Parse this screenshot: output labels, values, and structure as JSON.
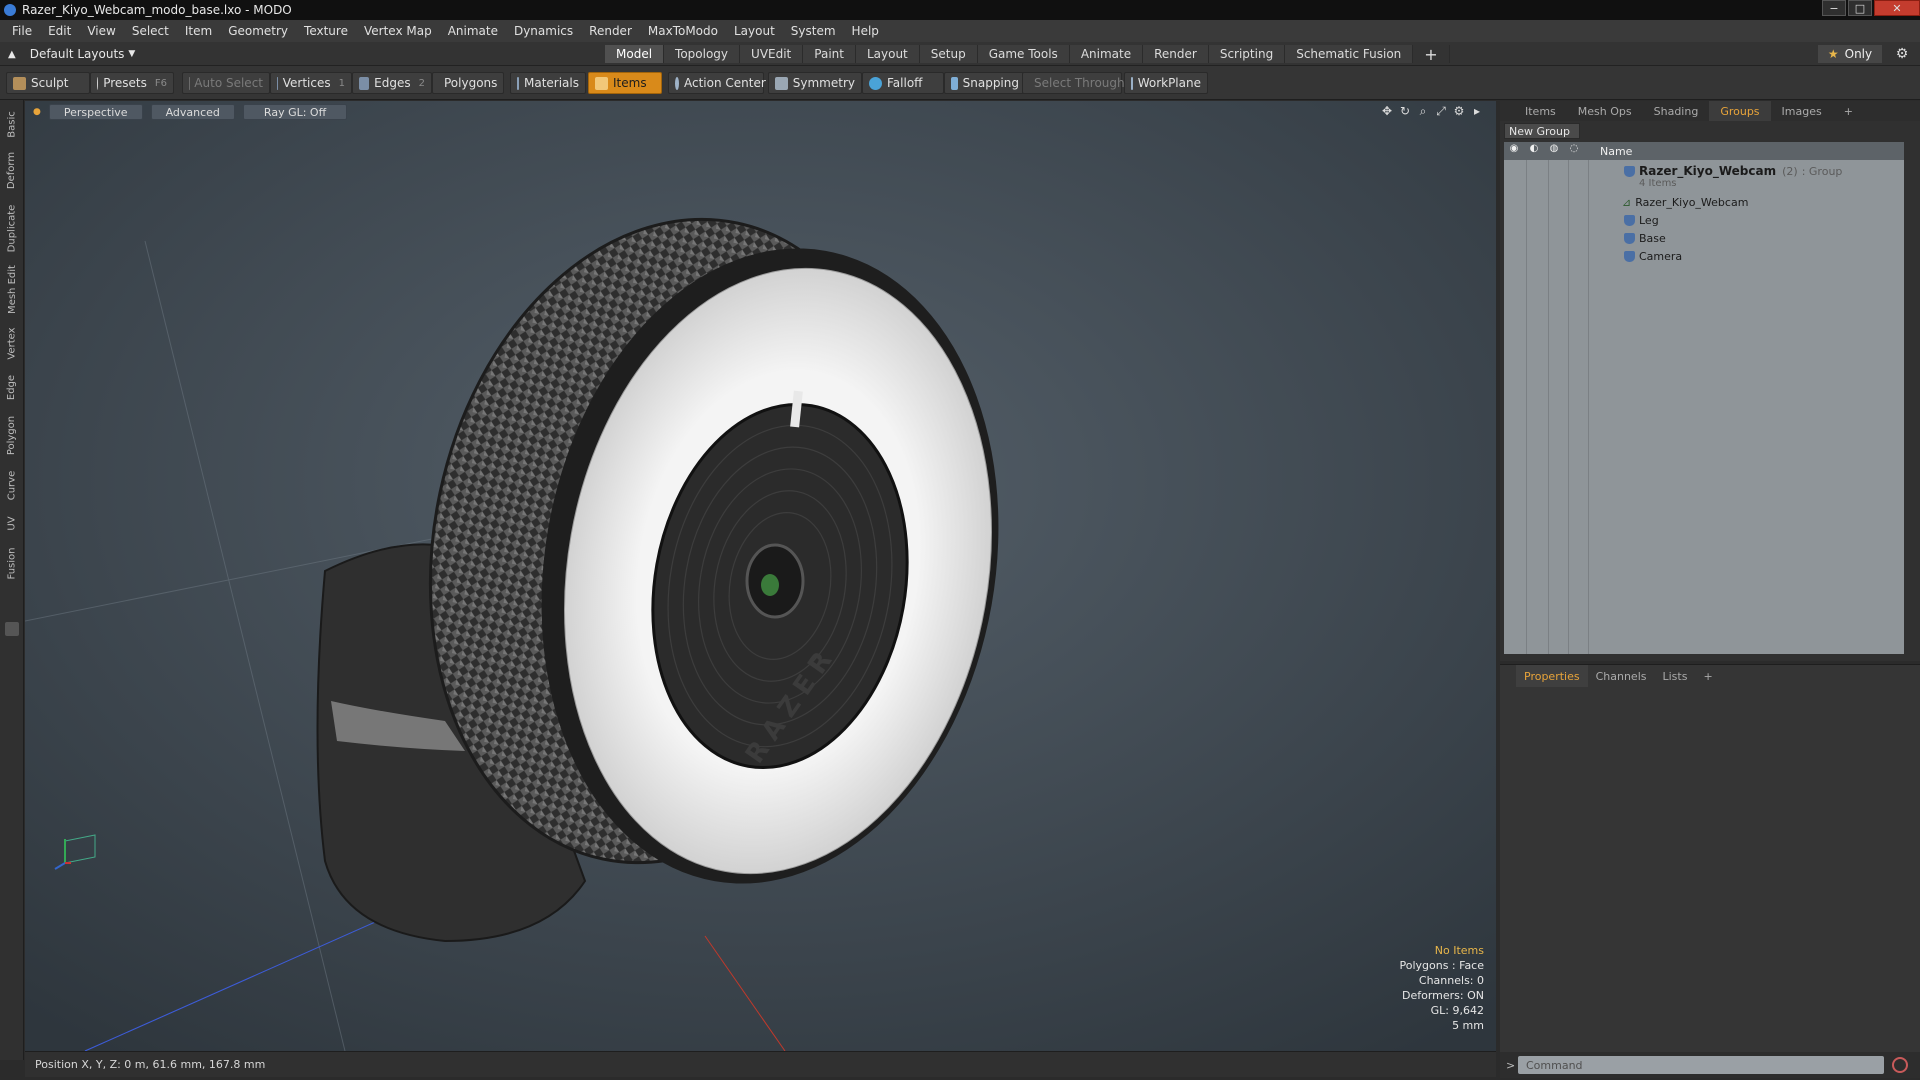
{
  "window": {
    "title": "Razer_Kiyo_Webcam_modo_base.lxo - MODO",
    "minimize": "−",
    "maximize": "□",
    "close": "✕"
  },
  "menu": [
    "File",
    "Edit",
    "View",
    "Select",
    "Item",
    "Geometry",
    "Texture",
    "Vertex Map",
    "Animate",
    "Dynamics",
    "Render",
    "MaxToModo",
    "Layout",
    "System",
    "Help"
  ],
  "layout": {
    "selected": "Default Layouts",
    "only_label": "Only"
  },
  "modetabs": [
    "Model",
    "Topology",
    "UVEdit",
    "Paint",
    "Layout",
    "Setup",
    "Game Tools",
    "Animate",
    "Render",
    "Scripting",
    "Schematic Fusion"
  ],
  "toolbar": {
    "sculpt": "Sculpt",
    "presets": "Presets",
    "presets_key": "F6",
    "auto_select": "Auto Select",
    "vertices": "Vertices",
    "vertices_key": "1",
    "edges": "Edges",
    "edges_key": "2",
    "polygons": "Polygons",
    "materials": "Materials",
    "items": "Items",
    "action_center": "Action Center",
    "symmetry": "Symmetry",
    "falloff": "Falloff",
    "snapping": "Snapping",
    "select_through": "Select Through",
    "workplane": "WorkPlane"
  },
  "lefttabs": [
    "Basic",
    "Deform",
    "Duplicate",
    "Mesh Edit",
    "Vertex",
    "Edge",
    "Polygon",
    "Curve",
    "UV",
    "Fusion"
  ],
  "viewport": {
    "view": "Perspective",
    "shading": "Advanced",
    "raygl": "Ray GL: Off",
    "logo_text": "RAZER",
    "info": {
      "no_items": "No Items",
      "polygons": "Polygons : Face",
      "channels": "Channels: 0",
      "deformers": "Deformers: ON",
      "gl": "GL: 9,642",
      "scale": "5 mm"
    }
  },
  "status": {
    "position": "Position X, Y, Z:  0 m, 61.6 mm, 167.8 mm"
  },
  "groups_panel": {
    "tabs": [
      "Items",
      "Mesh Ops",
      "Shading",
      "Groups",
      "Images"
    ],
    "active_tab": "Groups",
    "new_group": "New Group",
    "name_header": "Name",
    "group_name": "Razer_Kiyo_Webcam",
    "group_count": "(2)",
    "group_type": ": Group",
    "group_items": "4 Items",
    "children": [
      "Razer_Kiyo_Webcam",
      "Leg",
      "Base",
      "Camera"
    ]
  },
  "properties_panel": {
    "tabs": [
      "Properties",
      "Channels",
      "Lists"
    ],
    "active_tab": "Properties"
  },
  "command": {
    "placeholder": "Command",
    "prompt": ">"
  },
  "colors": {
    "accent": "#e8a43a",
    "items_active": "#d98a1a",
    "viewport_bg": "#46505a"
  }
}
